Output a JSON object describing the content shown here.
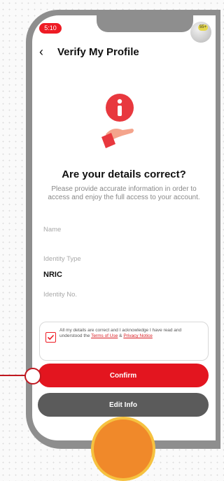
{
  "status_bar": {
    "time": "5:10",
    "avatar_badge": "55+"
  },
  "header": {
    "title": "Verify My Profile"
  },
  "content": {
    "headline": "Are your details correct?",
    "subtext": "Please provide accurate information in order to access and enjoy the full access to your account."
  },
  "fields": {
    "name_label": "Name",
    "identity_type_label": "Identity Type",
    "identity_type_value": "NRIC",
    "identity_no_label": "Identity No."
  },
  "consent": {
    "text_before": "All my details are correct and I acknowledge I have read and understood the ",
    "terms_link": "Terms of Use",
    "and": " & ",
    "privacy_link": "Privacy Notice"
  },
  "buttons": {
    "confirm": "Confirm",
    "edit": "Edit Info"
  },
  "colors": {
    "brand_red": "#e3151f",
    "secondary_gray": "#5b5b5b",
    "frame_gray": "#8e8e8e"
  }
}
